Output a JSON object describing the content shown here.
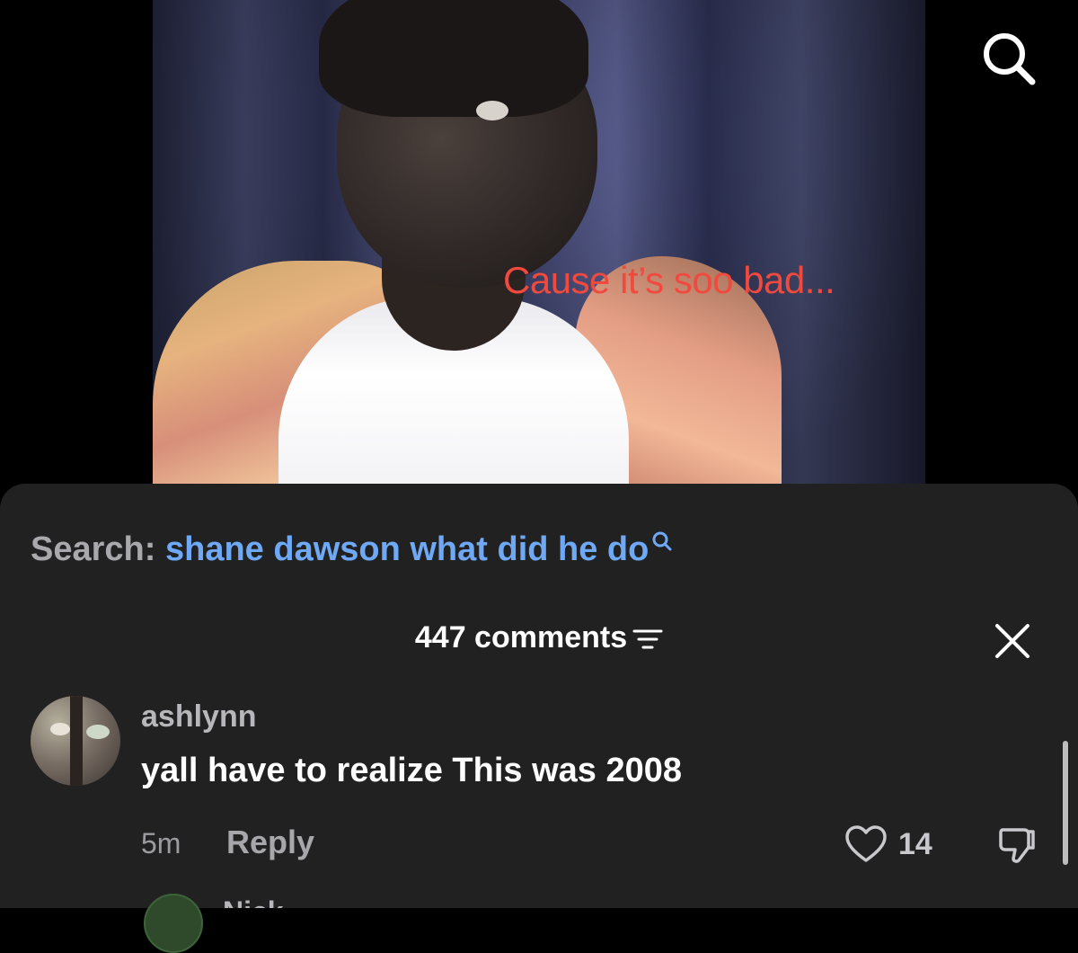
{
  "video": {
    "caption": "Cause it’s soo bad..."
  },
  "top_bar": {
    "search_icon": "search-icon"
  },
  "search_suggestion": {
    "label": "Search:",
    "query": "shane dawson what did he do",
    "icon": "search-icon"
  },
  "comments": {
    "count_label": "447 comments",
    "sort_icon": "sort-icon",
    "close_icon": "close-icon",
    "items": [
      {
        "username": "ashlynn",
        "text": "yall have to realize This was 2008",
        "time": "5m",
        "reply_label": "Reply",
        "likes": "14"
      }
    ],
    "next_item_partial_name": "Nick"
  },
  "colors": {
    "sheet_bg": "#212121",
    "link_blue": "#6fa8f5",
    "caption_red": "#f04a3e"
  }
}
